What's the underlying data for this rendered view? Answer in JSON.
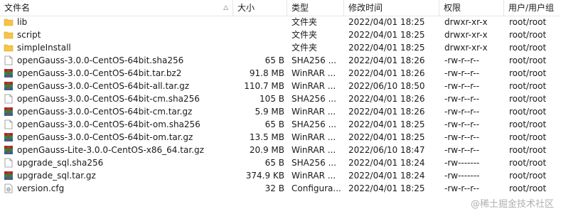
{
  "columns": {
    "name": "文件名",
    "size": "大小",
    "type": "类型",
    "modified": "修改时间",
    "permissions": "权限",
    "owner": "用户/用户组"
  },
  "files": [
    {
      "name": "lib",
      "size": "",
      "type": "文件夹",
      "modified": "2022/04/01 18:25",
      "permissions": "drwxr-xr-x",
      "owner": "root/root",
      "icon": "folder-icon"
    },
    {
      "name": "script",
      "size": "",
      "type": "文件夹",
      "modified": "2022/04/01 18:25",
      "permissions": "drwxr-xr-x",
      "owner": "root/root",
      "icon": "folder-icon"
    },
    {
      "name": "simpleInstall",
      "size": "",
      "type": "文件夹",
      "modified": "2022/04/01 18:25",
      "permissions": "drwxr-xr-x",
      "owner": "root/root",
      "icon": "folder-icon"
    },
    {
      "name": "openGauss-3.0.0-CentOS-64bit.sha256",
      "size": "65 B",
      "type": "SHA256 ...",
      "modified": "2022/04/01 18:26",
      "permissions": "-rw-r--r--",
      "owner": "root/root",
      "icon": "file-icon"
    },
    {
      "name": "openGauss-3.0.0-CentOS-64bit.tar.bz2",
      "size": "91.8 MB",
      "type": "WinRAR ...",
      "modified": "2022/04/01 18:26",
      "permissions": "-rw-r--r--",
      "owner": "root/root",
      "icon": "winrar-archive-icon"
    },
    {
      "name": "openGauss-3.0.0-CentOS-64bit-all.tar.gz",
      "size": "110.7 MB",
      "type": "WinRAR ...",
      "modified": "2022/06/10 18:50",
      "permissions": "-rw-r--r--",
      "owner": "root/root",
      "icon": "winrar-archive-icon"
    },
    {
      "name": "openGauss-3.0.0-CentOS-64bit-cm.sha256",
      "size": "105 B",
      "type": "SHA256 ...",
      "modified": "2022/04/01 18:26",
      "permissions": "-rw-r--r--",
      "owner": "root/root",
      "icon": "file-icon"
    },
    {
      "name": "openGauss-3.0.0-CentOS-64bit-cm.tar.gz",
      "size": "5.9 MB",
      "type": "WinRAR ...",
      "modified": "2022/04/01 18:26",
      "permissions": "-rw-r--r--",
      "owner": "root/root",
      "icon": "winrar-archive-icon"
    },
    {
      "name": "openGauss-3.0.0-CentOS-64bit-om.sha256",
      "size": "65 B",
      "type": "SHA256 ...",
      "modified": "2022/04/01 18:25",
      "permissions": "-rw-r--r--",
      "owner": "root/root",
      "icon": "file-icon"
    },
    {
      "name": "openGauss-3.0.0-CentOS-64bit-om.tar.gz",
      "size": "13.5 MB",
      "type": "WinRAR ...",
      "modified": "2022/04/01 18:25",
      "permissions": "-rw-r--r--",
      "owner": "root/root",
      "icon": "winrar-archive-icon"
    },
    {
      "name": "openGauss-Lite-3.0.0-CentOS-x86_64.tar.gz",
      "size": "20.9 MB",
      "type": "WinRAR ...",
      "modified": "2022/06/10 18:47",
      "permissions": "-rw-r--r--",
      "owner": "root/root",
      "icon": "winrar-archive-icon"
    },
    {
      "name": "upgrade_sql.sha256",
      "size": "65 B",
      "type": "SHA256 ...",
      "modified": "2022/04/01 18:24",
      "permissions": "-rw-------",
      "owner": "root/root",
      "icon": "file-icon"
    },
    {
      "name": "upgrade_sql.tar.gz",
      "size": "374.9 KB",
      "type": "WinRAR ...",
      "modified": "2022/04/01 18:24",
      "permissions": "-rw-------",
      "owner": "root/root",
      "icon": "winrar-archive-icon"
    },
    {
      "name": "version.cfg",
      "size": "32 B",
      "type": "Configura...",
      "modified": "2022/04/01 18:25",
      "permissions": "-rw-r--r--",
      "owner": "root/root",
      "icon": "config-file-icon"
    }
  ],
  "watermark": "@稀土掘金技术社区",
  "colors": {
    "folder": "#f6c545",
    "winrar_red": "#b3262e",
    "winrar_green": "#2d8a3e",
    "winrar_blue": "#2f5fb3"
  }
}
